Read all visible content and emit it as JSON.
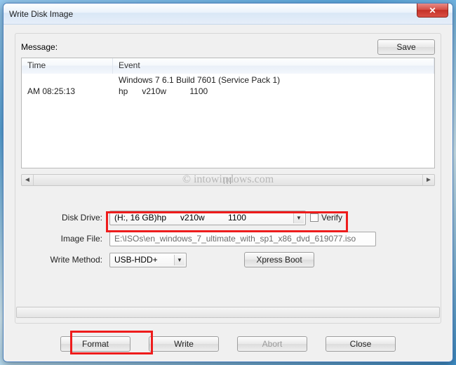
{
  "title": "Write Disk Image",
  "message_label": "Message:",
  "save_label": "Save",
  "columns": {
    "time": "Time",
    "event": "Event"
  },
  "log": [
    {
      "time": "",
      "event": "Windows 7 6.1 Build 7601 (Service Pack 1)"
    },
    {
      "time": "AM 08:25:13",
      "event": "hp      v210w          1100"
    }
  ],
  "watermark": "© intowindows.com",
  "labels": {
    "disk_drive": "Disk Drive:",
    "image_file": "Image File:",
    "write_method": "Write Method:"
  },
  "disk_drive_value": "(H:, 16 GB)hp      v210w          1100",
  "verify_label": "Verify",
  "image_file_value": "E:\\ISOs\\en_windows_7_ultimate_with_sp1_x86_dvd_619077.iso",
  "write_method_value": "USB-HDD+",
  "xpress_boot_label": "Xpress Boot",
  "buttons": {
    "format": "Format",
    "write": "Write",
    "abort": "Abort",
    "close": "Close"
  }
}
